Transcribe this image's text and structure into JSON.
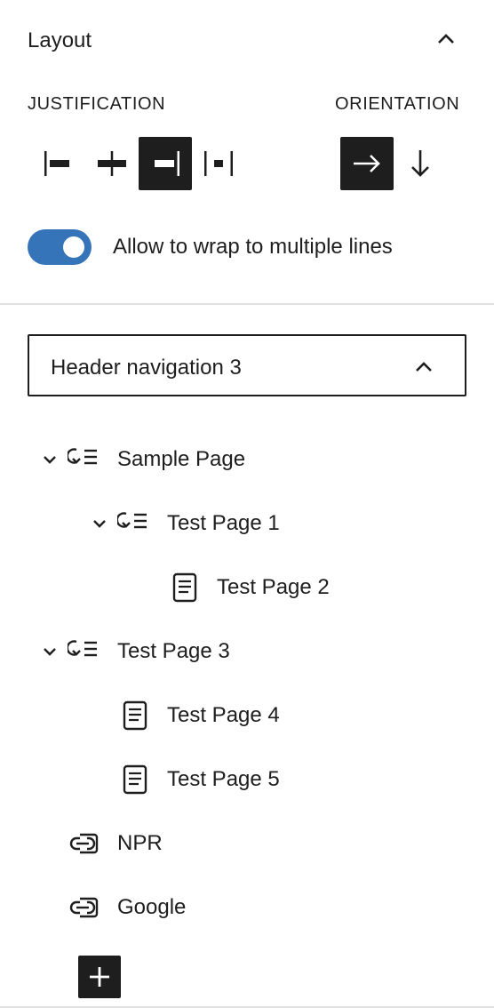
{
  "layout": {
    "title": "Layout",
    "justification_label": "JUSTIFICATION",
    "orientation_label": "ORIENTATION",
    "justification_options": [
      "justify-left",
      "justify-center",
      "justify-right",
      "justify-space-between"
    ],
    "justification_selected": "justify-right",
    "orientation_options": [
      "horizontal",
      "vertical"
    ],
    "orientation_selected": "horizontal",
    "wrap_toggle_label": "Allow to wrap to multiple lines",
    "wrap_enabled": true
  },
  "menu_select": {
    "value": "Header navigation 3"
  },
  "tree": [
    {
      "label": "Sample Page",
      "icon": "submenu-icon",
      "expandable": true,
      "depth": 0
    },
    {
      "label": "Test Page 1",
      "icon": "submenu-icon",
      "expandable": true,
      "depth": 1
    },
    {
      "label": "Test Page 2",
      "icon": "page-icon",
      "expandable": false,
      "depth": 2
    },
    {
      "label": "Test Page 3",
      "icon": "submenu-icon",
      "expandable": true,
      "depth": 0
    },
    {
      "label": "Test Page 4",
      "icon": "page-icon",
      "expandable": false,
      "depth": 1
    },
    {
      "label": "Test Page 5",
      "icon": "page-icon",
      "expandable": false,
      "depth": 1
    },
    {
      "label": "NPR",
      "icon": "custom-link-icon",
      "expandable": false,
      "depth": 0
    },
    {
      "label": "Google",
      "icon": "custom-link-icon",
      "expandable": false,
      "depth": 0
    }
  ],
  "colors": {
    "text": "#1e1e1e",
    "toggle_on": "#3574b8",
    "divider": "#e0e0e0",
    "active_button_bg": "#1e1e1e"
  }
}
